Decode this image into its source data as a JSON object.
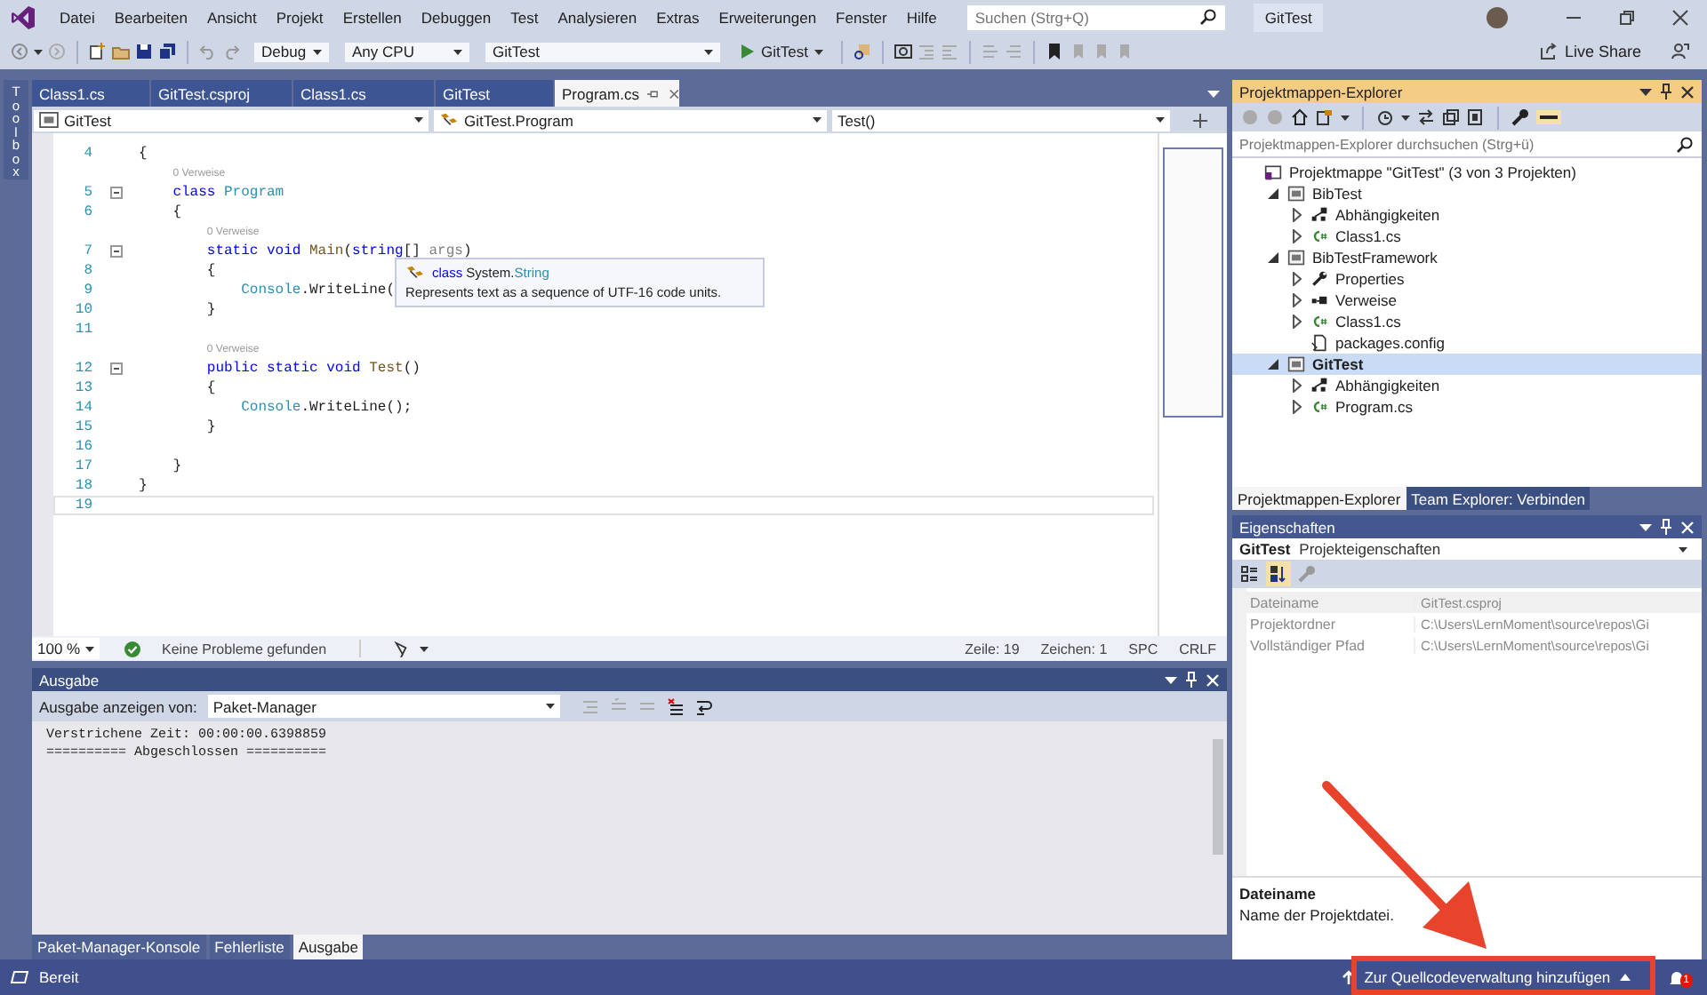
{
  "window": {
    "title": "GitTest",
    "search": {
      "placeholder": "Suchen (Strg+Q)"
    }
  },
  "menu": [
    "Datei",
    "Bearbeiten",
    "Ansicht",
    "Projekt",
    "Erstellen",
    "Debuggen",
    "Test",
    "Analysieren",
    "Extras",
    "Erweiterungen",
    "Fenster",
    "Hilfe"
  ],
  "toolbar": {
    "configuration": "Debug",
    "platform": "Any CPU",
    "startup_project": "GitTest",
    "run_button": "GitTest",
    "live_share": "Live Share"
  },
  "toolbox": {
    "label": "Toolbox"
  },
  "editor": {
    "tabs": [
      {
        "label": "Class1.cs",
        "selected": false
      },
      {
        "label": "GitTest.csproj",
        "selected": false
      },
      {
        "label": "Class1.cs",
        "selected": false
      },
      {
        "label": "GitTest",
        "selected": false
      },
      {
        "label": "Program.cs",
        "selected": true
      }
    ],
    "nav": [
      "GitTest",
      "GitTest.Program",
      "Test()"
    ],
    "lines": [
      {
        "kind": "code",
        "number": "4",
        "fold": false,
        "current": false,
        "segments": [
          {
            "kind": "plain",
            "text": "{"
          }
        ]
      },
      {
        "kind": "codelens",
        "text": "0 Verweise"
      },
      {
        "kind": "code",
        "number": "5",
        "fold": true,
        "current": false,
        "segments": [
          {
            "kind": "keyword",
            "text": "    class "
          },
          {
            "kind": "type",
            "text": "Program"
          }
        ]
      },
      {
        "kind": "code",
        "number": "6",
        "fold": false,
        "current": false,
        "segments": [
          {
            "kind": "plain",
            "text": "    {"
          }
        ]
      },
      {
        "kind": "codelens",
        "text": "0 Verweise"
      },
      {
        "kind": "code",
        "number": "7",
        "fold": true,
        "current": false,
        "segments": [
          {
            "kind": "keyword",
            "text": "        static void "
          },
          {
            "kind": "method",
            "text": "Main"
          },
          {
            "kind": "plain",
            "text": "("
          },
          {
            "kind": "keyword",
            "text": "string"
          },
          {
            "kind": "plain",
            "text": "[] "
          },
          {
            "kind": "param",
            "text": "args"
          },
          {
            "kind": "plain",
            "text": ")"
          }
        ]
      },
      {
        "kind": "code",
        "number": "8",
        "fold": false,
        "current": false,
        "segments": [
          {
            "kind": "plain",
            "text": "        {"
          }
        ]
      },
      {
        "kind": "code",
        "number": "9",
        "fold": false,
        "current": false,
        "segments": [
          {
            "kind": "type",
            "text": "            Console"
          },
          {
            "kind": "plain",
            "text": ".WriteLine("
          }
        ]
      },
      {
        "kind": "code",
        "number": "10",
        "fold": false,
        "current": false,
        "segments": [
          {
            "kind": "plain",
            "text": "        }"
          }
        ]
      },
      {
        "kind": "code",
        "number": "11",
        "fold": false,
        "current": false
      },
      {
        "kind": "codelens",
        "text": "0 Verweise"
      },
      {
        "kind": "code",
        "number": "12",
        "fold": true,
        "current": false,
        "segments": [
          {
            "kind": "keyword",
            "text": "        public static void "
          },
          {
            "kind": "method",
            "text": "Test"
          },
          {
            "kind": "plain",
            "text": "()"
          }
        ]
      },
      {
        "kind": "code",
        "number": "13",
        "fold": false,
        "current": false,
        "segments": [
          {
            "kind": "plain",
            "text": "        {"
          }
        ]
      },
      {
        "kind": "code",
        "number": "14",
        "fold": false,
        "current": false,
        "segments": [
          {
            "kind": "type",
            "text": "            Console"
          },
          {
            "kind": "plain",
            "text": ".WriteLine();"
          }
        ]
      },
      {
        "kind": "code",
        "number": "15",
        "fold": false,
        "current": false,
        "segments": [
          {
            "kind": "plain",
            "text": "        }"
          }
        ]
      },
      {
        "kind": "code",
        "number": "16",
        "fold": false,
        "current": false
      },
      {
        "kind": "code",
        "number": "17",
        "fold": false,
        "current": false,
        "segments": [
          {
            "kind": "plain",
            "text": "    }"
          }
        ]
      },
      {
        "kind": "code",
        "number": "18",
        "fold": false,
        "current": false,
        "segments": [
          {
            "kind": "plain",
            "text": "}"
          }
        ]
      },
      {
        "kind": "code",
        "number": "19",
        "fold": false,
        "current": true
      }
    ],
    "tooltip": {
      "title": [
        {
          "kind": "keyword",
          "text": "class"
        },
        {
          "kind": "plain",
          "text": " System."
        },
        {
          "kind": "type",
          "text": "String"
        }
      ],
      "description": "Represents text as a sequence of UTF-16 code units."
    },
    "status": {
      "zoom": "100 %",
      "issues": "Keine Probleme gefunden",
      "line": "Zeile: 19",
      "column": "Zeichen: 1",
      "whitespace": "SPC",
      "line_ending": "CRLF"
    }
  },
  "output": {
    "title": "Ausgabe",
    "source_label": "Ausgabe anzeigen von:",
    "source": "Paket-Manager",
    "lines": [
      "Verstrichene Zeit: 00:00:00.6398859",
      "========== Abgeschlossen =========="
    ],
    "tabs": [
      {
        "label": "Paket-Manager-Konsole",
        "selected": false
      },
      {
        "label": "Fehlerliste",
        "selected": false
      },
      {
        "label": "Ausgabe",
        "selected": true
      }
    ]
  },
  "solution_explorer": {
    "title": "Projektmappen-Explorer",
    "preview_on": true,
    "search": {
      "placeholder": "Projektmappen-Explorer durchsuchen (Strg+ü)"
    },
    "tree": [
      {
        "label": "Projektmappe \"GitTest\" (3 von 3 Projekten)",
        "kind": "solution",
        "selected": false,
        "children": [
          {
            "label": "BibTest",
            "kind": "project",
            "expanded": true,
            "selected": false,
            "children": [
              {
                "label": "Abhängigkeiten",
                "kind": "dependencies",
                "expanded": false,
                "selected": false
              },
              {
                "label": "Class1.cs",
                "kind": "csharp",
                "expanded": false,
                "selected": false
              }
            ]
          },
          {
            "label": "BibTestFramework",
            "kind": "project",
            "expanded": true,
            "selected": false,
            "children": [
              {
                "label": "Properties",
                "kind": "wrench",
                "expanded": false,
                "selected": false
              },
              {
                "label": "Verweise",
                "kind": "references",
                "expanded": false,
                "selected": false
              },
              {
                "label": "Class1.cs",
                "kind": "csharp",
                "expanded": false,
                "selected": false
              },
              {
                "label": "packages.config",
                "kind": "config",
                "selected": false
              }
            ]
          },
          {
            "label": "GitTest",
            "kind": "project",
            "expanded": true,
            "selected": true,
            "children": [
              {
                "label": "Abhängigkeiten",
                "kind": "dependencies",
                "expanded": false,
                "selected": false
              },
              {
                "label": "Program.cs",
                "kind": "csharp",
                "expanded": false,
                "selected": false
              }
            ]
          }
        ]
      }
    ],
    "tabs": [
      {
        "label": "Projektmappen-Explorer",
        "selected": true
      },
      {
        "label": "Team Explorer: Verbinden",
        "selected": false
      }
    ]
  },
  "properties": {
    "title": "Eigenschaften",
    "object": "GitTest",
    "object_type": "Projekteigenschaften",
    "sort_alphabetical": true,
    "rows": [
      {
        "name": "Dateiname",
        "value": "GitTest.csproj",
        "selected": true
      },
      {
        "name": "Projektordner",
        "value": "C:\\Users\\LernMoment\\source\\repos\\Gi",
        "selected": false
      },
      {
        "name": "Vollständiger Pfad",
        "value": "C:\\Users\\LernMoment\\source\\repos\\Gi",
        "selected": false
      }
    ],
    "description": {
      "title": "Dateiname",
      "text": "Name der Projektdatei."
    }
  },
  "status_bar": {
    "ready": "Bereit",
    "source_control": "Zur Quellcodeverwaltung hinzufügen",
    "notifications": "1"
  }
}
